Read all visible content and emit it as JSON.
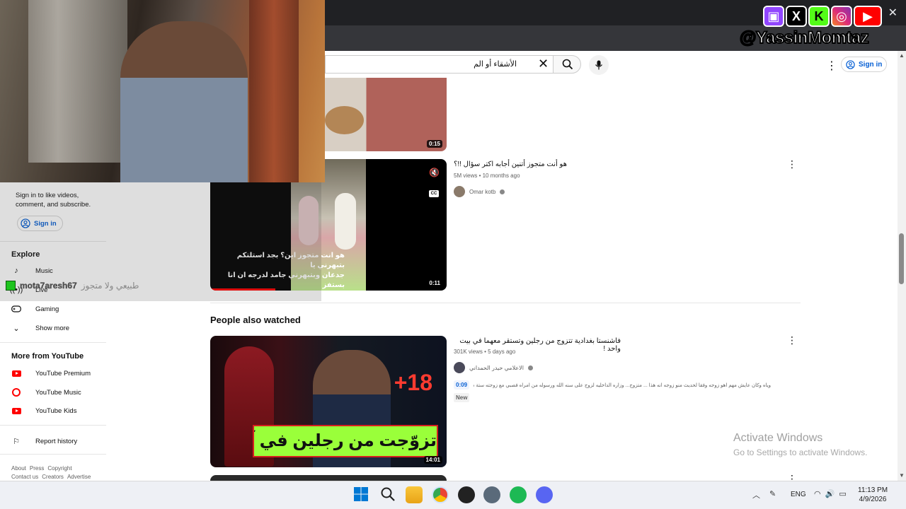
{
  "browser": {
    "close_glyph": "✕"
  },
  "search": {
    "query": "الأشقاء أو الم",
    "clear_glyph": "✕"
  },
  "header": {
    "signin_label": "Sign in",
    "more_glyph": "⋮"
  },
  "sidebar": {
    "signin_prompt": "Sign in to like videos, comment, and subscribe.",
    "signin_label": "Sign in",
    "explore_heading": "Explore",
    "explore_items": [
      {
        "label": "Music",
        "icon": "music-note-icon"
      },
      {
        "label": "Live",
        "icon": "live-icon"
      },
      {
        "label": "Gaming",
        "icon": "gaming-icon"
      },
      {
        "label": "Show more",
        "icon": "chevron-down-icon"
      }
    ],
    "more_heading": "More from YouTube",
    "more_items": [
      {
        "label": "YouTube Premium"
      },
      {
        "label": "YouTube Music"
      },
      {
        "label": "YouTube Kids"
      }
    ],
    "report_label": "Report history",
    "footer_row1": [
      "About",
      "Press",
      "Copyright"
    ],
    "footer_row2": [
      "Contact us",
      "Creators",
      "Advertise"
    ]
  },
  "videos": [
    {
      "duration": "0:15"
    },
    {
      "title": "هو أنت متجوز أتنين أجابه اكتر سؤال !!؟",
      "meta": "5M views • 10 months ago",
      "channel": "Omar kotb",
      "duration": "0:11",
      "caption_line1": "هو انت متجوز اين؟ بجد استلتكم بتبهرني يا",
      "caption_line2": "جدعان وبتبهرني جامد لدرجه ان انا بستفز"
    }
  ],
  "section_heading": "People also watched",
  "featured": {
    "title": "فاشنستا بغدادية تتزوج من رجلين وتستقر معهما في بيت واحد !",
    "meta": "301K views • 5 days ago",
    "channel": "الاعلامي حيدر الحمداني",
    "timestamp": "0:09",
    "snippet": "وياه وكان عايش مهم اهو زوجه وفقا لحديث منو زوجه انه هذا ... متزوج... وزاره الداخليه لزوج على سنه الله ورسوله من امراه فصبي مع زوجته ستة سنوات",
    "badge": "New",
    "duration": "14:01",
    "thumb_overlay": "تزوّجت من رجلين في آنٍ واحد",
    "thumb_tag": "+18"
  },
  "overlay": {
    "chat_user": "mota7aresh67",
    "chat_message": "طبيعي ولا متجوز",
    "handle": "@YassinMomtaz",
    "socials": [
      "twitch-icon",
      "x-icon",
      "kick-icon",
      "instagram-icon",
      "youtube-icon"
    ]
  },
  "activate": {
    "line1": "Activate Windows",
    "line2": "Go to Settings to activate Windows."
  },
  "taskbar": {
    "lang": "ENG",
    "time": "11:13 PM",
    "date": "4/9/2026",
    "chevron": "︿"
  },
  "colors": {
    "accent": "#065fd4",
    "brand_red": "#ff0000",
    "kick_green": "#53fc18"
  }
}
